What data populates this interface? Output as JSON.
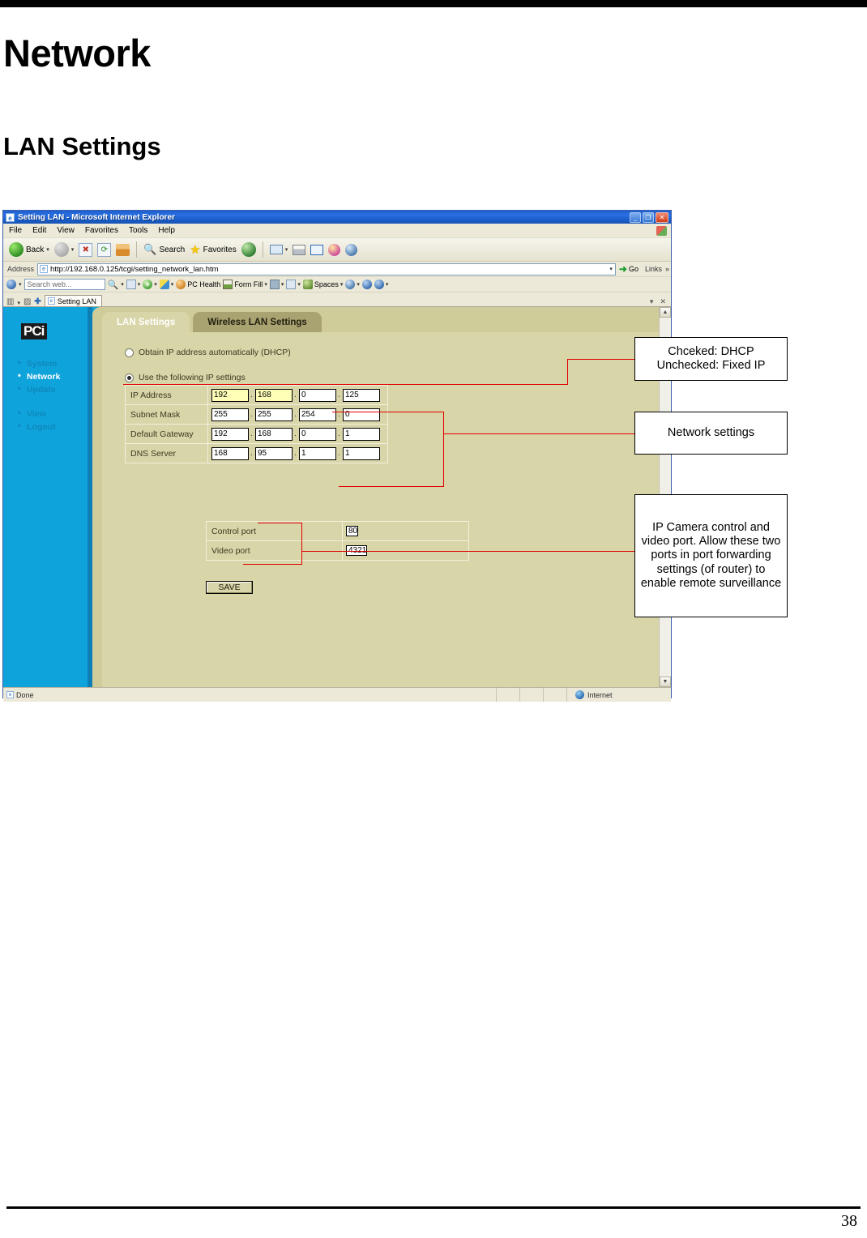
{
  "document": {
    "h1": "Network",
    "h2": "LAN Settings",
    "page_number": "38"
  },
  "browser": {
    "window_title": "Setting LAN - Microsoft Internet Explorer",
    "window_buttons": {
      "minimize": "_",
      "restore": "❐",
      "close": "✕"
    },
    "menu": [
      "File",
      "Edit",
      "View",
      "Favorites",
      "Tools",
      "Help"
    ],
    "toolbar": {
      "back_label": "Back",
      "forward_label": "",
      "stop_label": "",
      "refresh_label": "",
      "home_label": "",
      "search_label": "Search",
      "favorites_label": "Favorites",
      "media_label": "",
      "dropdown_caret": "▾"
    },
    "address_bar": {
      "label": "Address",
      "url": "http://192.168.0.125/tcgi/setting_network_lan.htm",
      "dropdown_caret": "▾",
      "go_label": "Go",
      "go_arrow": "➜",
      "links_label": "Links",
      "overflow_chevron": "»"
    },
    "search_bar": {
      "placeholder": "Search web...",
      "items": [
        {
          "label": "PC Health",
          "icon": "shield-icon"
        },
        {
          "label": "Form Fill",
          "icon": "form-fill-icon"
        },
        {
          "label": "Spaces",
          "icon": "spaces-icon"
        }
      ],
      "caret": "▾"
    },
    "tab_bar": {
      "tab_label": "Setting LAN",
      "close_icon": "✕",
      "list_caret": "▾"
    },
    "status_bar": {
      "status": "Done",
      "zone": "Internet"
    },
    "scrollbar": {
      "up": "▲",
      "down": "▼"
    }
  },
  "webpage": {
    "logo": "PCi",
    "sidebar": [
      {
        "label": "System",
        "active": false
      },
      {
        "label": "Network",
        "active": true
      },
      {
        "label": "Update",
        "active": false
      },
      {
        "label": "View",
        "active": false
      },
      {
        "label": "Logout",
        "active": false
      }
    ],
    "tabs": [
      {
        "label": "LAN Settings",
        "active": true
      },
      {
        "label": "Wireless LAN Settings",
        "active": false
      }
    ],
    "ip_mode": {
      "dhcp_label": "Obtain IP address automatically (DHCP)",
      "dhcp_selected": false,
      "static_label": "Use the following IP settings",
      "static_selected": true
    },
    "network_table": [
      {
        "name": "IP Address",
        "octets": [
          "192",
          "168",
          "0",
          "125"
        ],
        "highlight": [
          true,
          true,
          false,
          false
        ]
      },
      {
        "name": "Subnet Mask",
        "octets": [
          "255",
          "255",
          "254",
          "0"
        ],
        "highlight": [
          false,
          false,
          false,
          false
        ]
      },
      {
        "name": "Default Gateway",
        "octets": [
          "192",
          "168",
          "0",
          "1"
        ],
        "highlight": [
          false,
          false,
          false,
          false
        ]
      },
      {
        "name": "DNS Server",
        "octets": [
          "168",
          "95",
          "1",
          "1"
        ],
        "highlight": [
          false,
          false,
          false,
          false
        ]
      }
    ],
    "octet_separator": ".",
    "port_table": [
      {
        "name": "Control port",
        "value": "80"
      },
      {
        "name": "Video port",
        "value": "4321"
      }
    ],
    "save_button": "SAVE"
  },
  "annotations": [
    {
      "id": "dhcp-note",
      "text": "Chceked: DHCP\nUnchecked: Fixed IP"
    },
    {
      "id": "network-note",
      "text": "Network settings"
    },
    {
      "id": "ports-note",
      "text": "IP Camera control and video port. Allow these two ports in port forwarding settings (of router) to enable remote surveillance"
    }
  ],
  "colors": {
    "annotation_line": "#e10000",
    "sidebar_blue": "#0fa3dc",
    "panel_khaki": "#d8d5a8",
    "card_khaki": "#cfcc9a",
    "inactive_tab": "#a9a271",
    "autofill_yellow": "#ffffb8"
  }
}
